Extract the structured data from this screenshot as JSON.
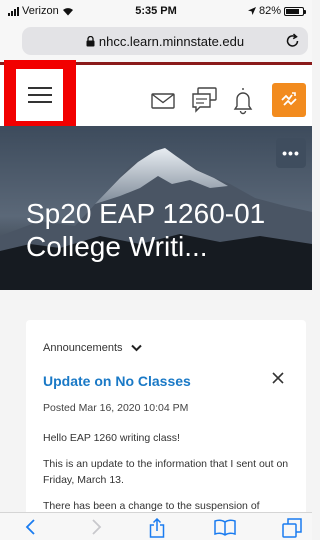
{
  "status_bar": {
    "carrier": "Verizon",
    "time": "5:35 PM",
    "battery_percent": "82%",
    "battery_level": 0.82
  },
  "browser": {
    "url": "nhcc.learn.minnstate.edu"
  },
  "course": {
    "title": "Sp20 EAP 1260-01 College Writi..."
  },
  "announcements": {
    "header": "Announcements",
    "item_title": "Update on No Classes",
    "posted": "Posted Mar 16, 2020 10:04 PM",
    "body": [
      "Hello EAP 1260 writing class!",
      "This is an update to the information that I sent out on Friday, March 13.",
      "There has been a change to the suspension of"
    ]
  },
  "colors": {
    "accent_link": "#1a79c6",
    "pulse_button": "#f28b1e",
    "highlight_box": "#f20000",
    "nav_border": "#8a1a1a"
  },
  "icons": {
    "status": [
      "signal-icon",
      "wifi-icon",
      "location-icon",
      "battery-icon"
    ],
    "nav": [
      "menu-icon",
      "mail-icon",
      "chat-icon",
      "bell-icon",
      "pulse-icon"
    ],
    "toolbar": [
      "back-icon",
      "forward-icon",
      "share-icon",
      "bookmarks-icon",
      "tabs-icon"
    ]
  }
}
